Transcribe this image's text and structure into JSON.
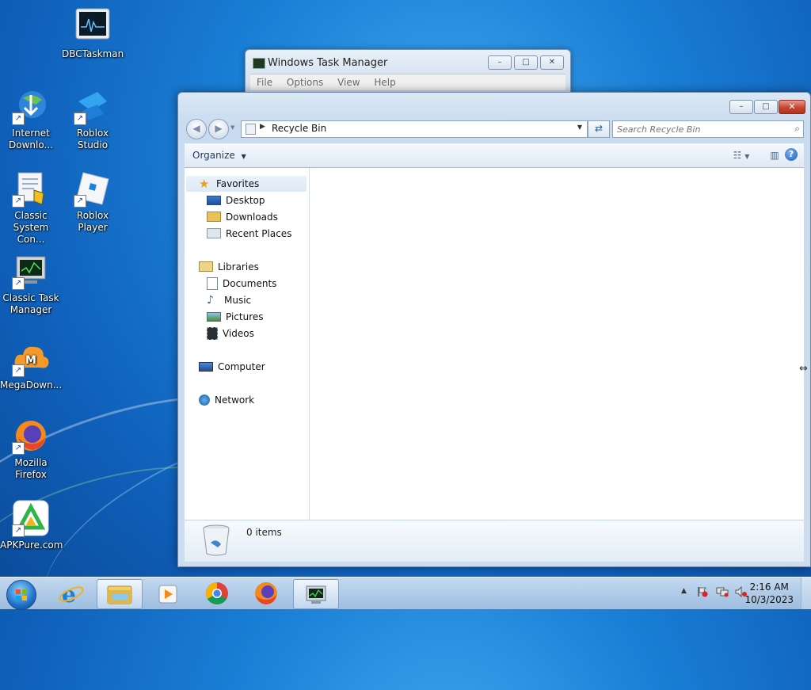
{
  "desktop": {
    "icons": [
      {
        "label": "DBCTaskman"
      },
      {
        "label": "Internet Downlo..."
      },
      {
        "label": "Roblox Studio"
      },
      {
        "label": "Classic System Con..."
      },
      {
        "label": "Roblox Player"
      },
      {
        "label": "Classic Task Manager"
      },
      {
        "label": "MegaDown..."
      },
      {
        "label": "Mozilla Firefox"
      },
      {
        "label": "APKPure.com"
      }
    ]
  },
  "task_manager": {
    "title": "Windows Task Manager",
    "menu": [
      "File",
      "Options",
      "View",
      "Help"
    ]
  },
  "explorer": {
    "address": "Recycle Bin",
    "search_placeholder": "Search Recycle Bin",
    "organize_label": "Organize",
    "nav": {
      "favorites": "Favorites",
      "desktop": "Desktop",
      "downloads": "Downloads",
      "recent": "Recent Places",
      "libraries": "Libraries",
      "documents": "Documents",
      "music": "Music",
      "pictures": "Pictures",
      "videos": "Videos",
      "computer": "Computer",
      "network": "Network"
    },
    "details": {
      "count": "0 items"
    }
  },
  "taskbar": {
    "pinned": [
      "internet-explorer",
      "windows-explorer",
      "media-player",
      "google-chrome",
      "mozilla-firefox",
      "task-manager"
    ],
    "active": [
      "windows-explorer",
      "task-manager"
    ],
    "time": "2:16 AM",
    "date": "10/3/2023"
  },
  "colors": {
    "accent": "#1a7fd6",
    "close_button": "#c9452f"
  }
}
